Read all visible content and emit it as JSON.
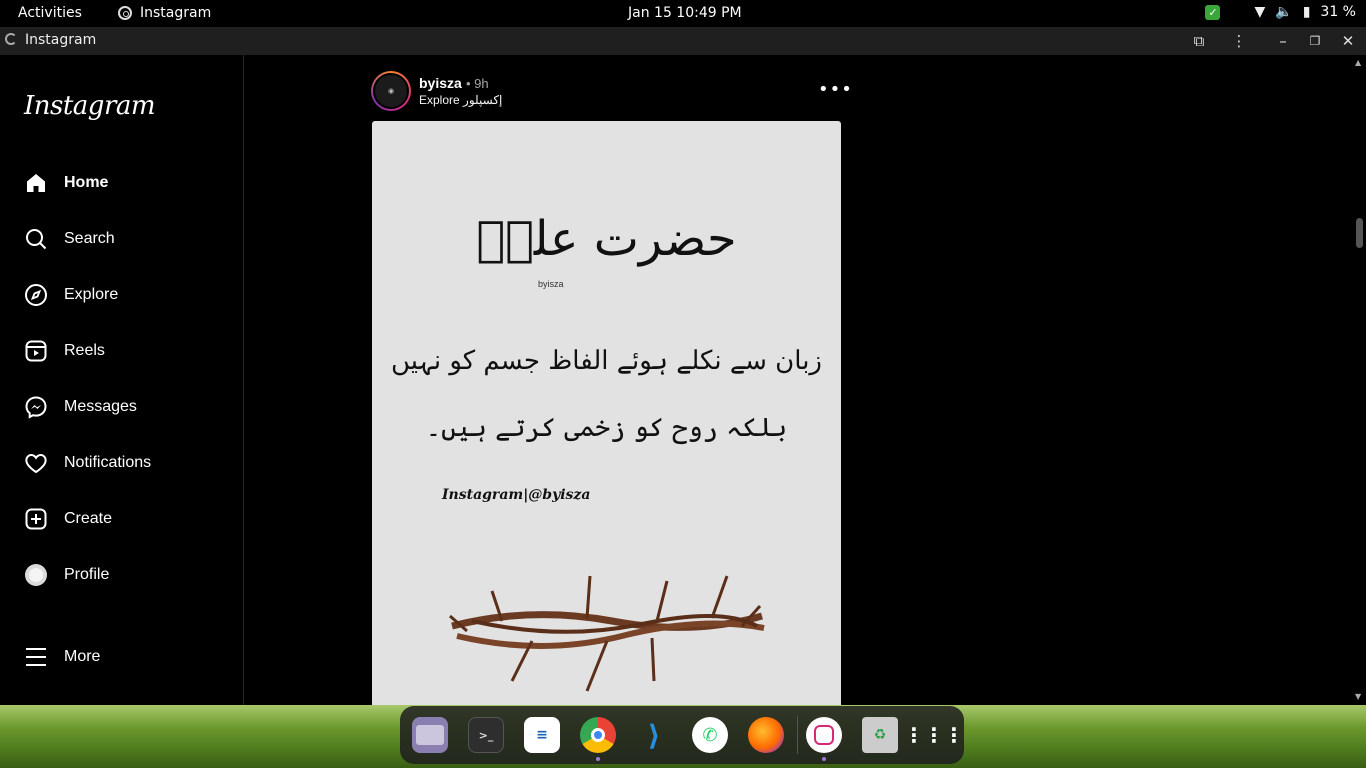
{
  "topbar": {
    "activities": "Activities",
    "app_name": "Instagram",
    "clock": "Jan 15  10:49 PM",
    "battery": "31 %"
  },
  "window": {
    "title": "Instagram"
  },
  "sidebar": {
    "logo": "Instagram",
    "items": [
      {
        "label": "Home",
        "icon": "home-icon"
      },
      {
        "label": "Search",
        "icon": "search-icon"
      },
      {
        "label": "Explore",
        "icon": "compass-icon"
      },
      {
        "label": "Reels",
        "icon": "reels-icon"
      },
      {
        "label": "Messages",
        "icon": "messenger-icon"
      },
      {
        "label": "Notifications",
        "icon": "heart-icon"
      },
      {
        "label": "Create",
        "icon": "plus-square-icon"
      },
      {
        "label": "Profile",
        "icon": "profile-avatar-icon"
      },
      {
        "label": "More",
        "icon": "hamburger-icon"
      }
    ]
  },
  "post": {
    "username": "byisza",
    "time": "• 9h",
    "subtitle": "Explore إکسپلور",
    "image": {
      "title": "حضرت علیؓ",
      "watermark": "byisza",
      "line1": "زبان سے نکلے ہوئے الفاظ جسم کو نہیں",
      "line2": "بلکہ روح کو زخمی کرتے ہیں۔",
      "handle": "Instagram|@byisza"
    }
  },
  "dock": {
    "apps": [
      "files",
      "terminal",
      "text-editor",
      "chrome",
      "vscode",
      "whatsapp",
      "firefox",
      "instagram",
      "trash",
      "app-grid"
    ]
  },
  "colors": {
    "background": "#000000",
    "post_image_bg": "#e2e2e2",
    "muted_text": "#a8a8a8"
  }
}
